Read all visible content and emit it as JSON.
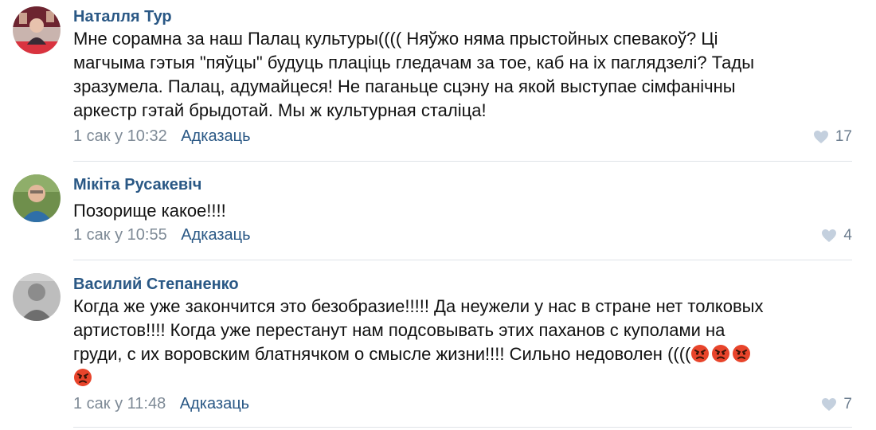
{
  "comments": [
    {
      "author": "Наталля Тур",
      "lines": [
        "Мне сорамна за наш Палац культуры(((( Няўжо няма прыстойных спевакоў? Ці",
        "магчыма гэтыя \"пяўцы\" будуць плаціць гледачам за тое, каб на іх паглядзелі? Тады",
        "зразумела. Палац, адумайцеся! Не паганьце сцэну на якой выступае сімфанічны",
        "аркестр гэтай брыдотай. Мы ж культурная сталіца!"
      ],
      "time": "1 сак у 10:32",
      "reply_label": "Адказаць",
      "likes": "17",
      "avatar_icon": "user-avatar-photo"
    },
    {
      "author": "Мікіта Русакевіч",
      "lines": [
        "Позорище какое!!!!"
      ],
      "time": "1 сак у 10:55",
      "reply_label": "Адказаць",
      "likes": "4",
      "avatar_icon": "user-avatar-photo"
    },
    {
      "author": "Василий Степаненко",
      "lines": [
        "Когда же уже закончится это безобразие!!!!! Да неужели у нас в стране нет толковых",
        "артистов!!!! Когда уже перестанут нам подсовывать этих паханов с куполами на",
        "груди, с их воровским блатнячком о смысле жизни!!!! Сильно недоволен (((("
      ],
      "time": "1 сак у 11:48",
      "reply_label": "Адказаць",
      "likes": "7",
      "avatar_icon": "user-avatar-photo",
      "emojis": [
        "angry-face-emoji",
        "angry-face-emoji",
        "angry-face-emoji",
        "angry-face-emoji"
      ]
    }
  ],
  "colors": {
    "author": "#2a5885",
    "reply": "#2a5885",
    "meta": "#7e8a96",
    "like": "#6b7c8e",
    "heart": "#c4d0de",
    "divider": "#dfe3e8",
    "emoji_red": "#e8442b"
  },
  "icons": {
    "like": "heart-icon"
  }
}
